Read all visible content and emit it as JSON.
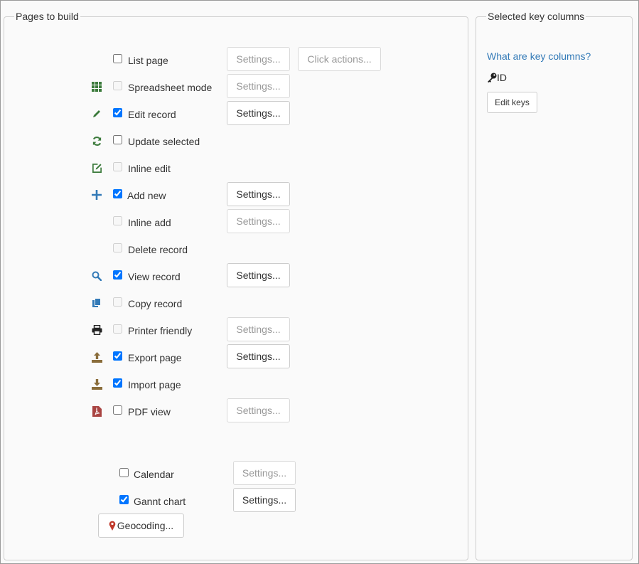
{
  "pages_section": {
    "legend": "Pages to build",
    "settings_label": "Settings...",
    "click_actions_label": "Click actions...",
    "rows": [
      {
        "label": "List page",
        "checked": false,
        "disabled": false
      },
      {
        "label": "Spreadsheet mode",
        "checked": false,
        "disabled": true,
        "icon": "grid-icon"
      },
      {
        "label": "Edit record",
        "checked": true,
        "disabled": false,
        "icon": "pencil-icon"
      },
      {
        "label": "Update selected",
        "checked": false,
        "disabled": false,
        "icon": "refresh-icon"
      },
      {
        "label": "Inline edit",
        "checked": false,
        "disabled": true,
        "icon": "edit-box-icon"
      },
      {
        "label": "Add new",
        "checked": true,
        "disabled": false,
        "icon": "plus-icon"
      },
      {
        "label": "Inline add",
        "checked": false,
        "disabled": true
      },
      {
        "label": "Delete record",
        "checked": false,
        "disabled": true
      },
      {
        "label": "View record",
        "checked": true,
        "disabled": false,
        "icon": "search-icon"
      },
      {
        "label": "Copy record",
        "checked": false,
        "disabled": true,
        "icon": "copy-icon"
      },
      {
        "label": "Printer friendly",
        "checked": false,
        "disabled": true,
        "icon": "printer-icon"
      },
      {
        "label": "Export page",
        "checked": true,
        "disabled": false,
        "icon": "export-icon"
      },
      {
        "label": "Import page",
        "checked": true,
        "disabled": false,
        "icon": "import-icon"
      },
      {
        "label": "PDF view",
        "checked": false,
        "disabled": false,
        "icon": "pdf-icon"
      }
    ],
    "extra_rows": [
      {
        "label": "Calendar",
        "checked": false
      },
      {
        "label": "Gannt chart",
        "checked": true
      }
    ],
    "geocoding_label": "Geocoding...",
    "geocoding_icon": "map-marker-icon"
  },
  "keys_section": {
    "legend": "Selected key columns",
    "help_link": "What are key columns?",
    "key_icon": "key-icon",
    "key_column": "ID",
    "edit_keys_label": "Edit keys"
  },
  "colors": {
    "link": "#337ab7",
    "icon_green": "#3b7a3b",
    "icon_blue": "#337ab7",
    "icon_brown": "#8a6d3b",
    "icon_red": "#a94442"
  }
}
